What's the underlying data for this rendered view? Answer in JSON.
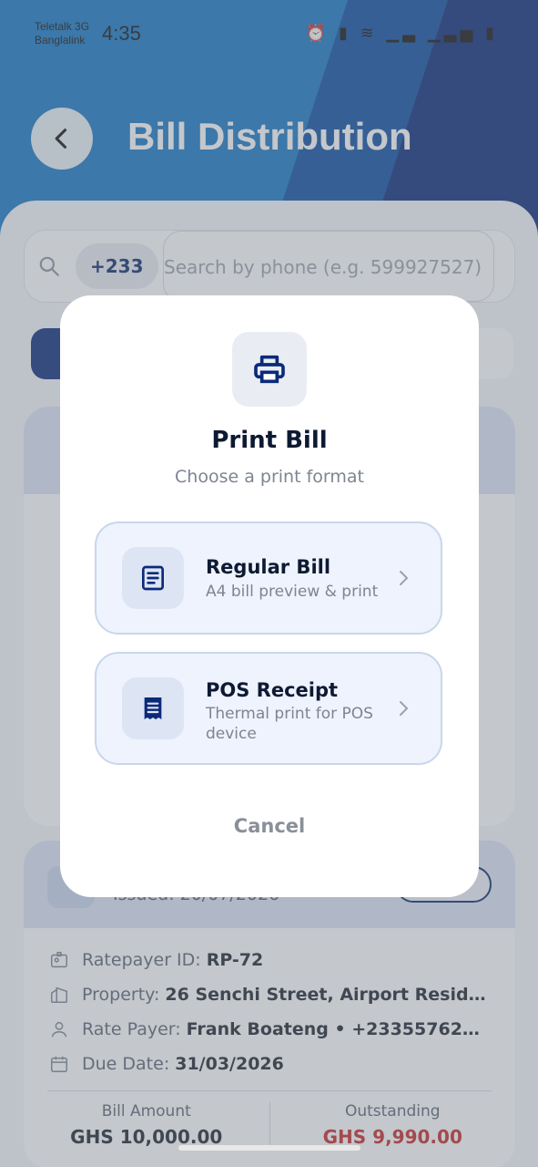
{
  "status_bar": {
    "carrier1": "Teletalk 3G",
    "carrier2": "Banglalink",
    "time": "4:35",
    "icons": "⏰ ▮ ≋ ▁▃ ▁▃▅ ▮"
  },
  "header": {
    "title": "Bill Distribution",
    "back_icon": "chevron-left-icon"
  },
  "search": {
    "country_code": "+233",
    "placeholder": "Search by phone (e.g. 599927527)"
  },
  "bill_card": {
    "issued": "Issued: 20/07/2026",
    "rows": [
      {
        "label": "Ratepayer ID:",
        "value": "RP-72",
        "icon": "id-badge-icon"
      },
      {
        "label": "Property:",
        "value": "26 Senchi Street, Airport Residenti...",
        "icon": "building-icon"
      },
      {
        "label": "Rate Payer:",
        "value": "Frank Boateng • +233557623996",
        "icon": "person-icon"
      },
      {
        "label": "Due Date:",
        "value": "31/03/2026",
        "icon": "calendar-icon"
      }
    ],
    "bill_amount_label": "Bill Amount",
    "bill_amount": "GHS 10,000.00",
    "outstanding_label": "Outstanding",
    "outstanding": "GHS 9,990.00",
    "outstanding_color": "#c62828"
  },
  "modal": {
    "title": "Print Bill",
    "subtitle": "Choose a print format",
    "icon": "printer-icon",
    "options": [
      {
        "title": "Regular Bill",
        "description": "A4 bill preview & print",
        "icon": "document-icon"
      },
      {
        "title": "POS Receipt",
        "description": "Thermal print for POS device",
        "icon": "receipt-icon"
      }
    ],
    "cancel_label": "Cancel"
  },
  "colors": {
    "accent": "#0b2a7a",
    "header_blue": "#1677c4",
    "option_bg": "#eef3fd"
  }
}
